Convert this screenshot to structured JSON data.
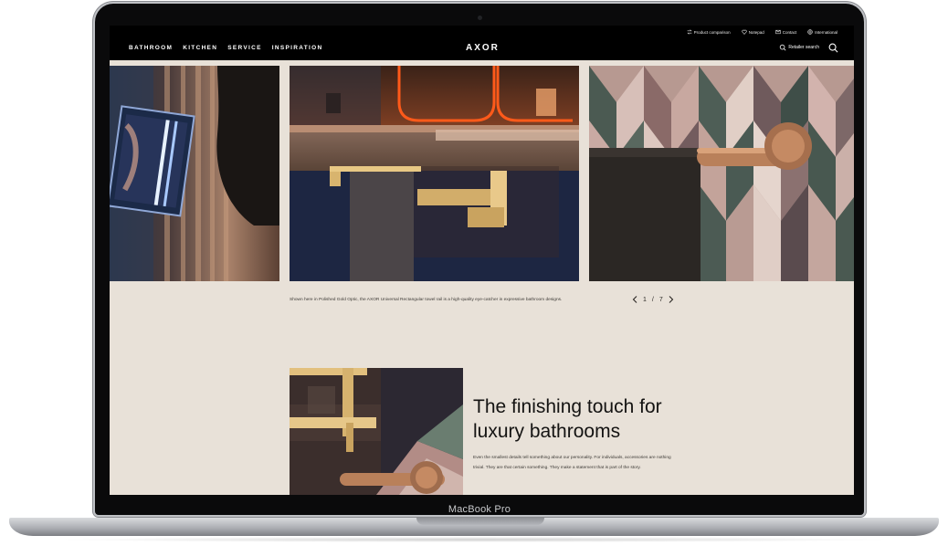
{
  "device": {
    "label": "MacBook Pro"
  },
  "header": {
    "utility_links": [
      {
        "label": "Product comparison",
        "icon": "compare-icon"
      },
      {
        "label": "Notepad",
        "icon": "heart-icon"
      },
      {
        "label": "Contact",
        "icon": "mail-icon"
      },
      {
        "label": "International",
        "icon": "globe-icon"
      }
    ],
    "nav": [
      {
        "label": "BATHROOM"
      },
      {
        "label": "KITCHEN"
      },
      {
        "label": "SERVICE"
      },
      {
        "label": "INSPIRATION"
      }
    ],
    "logo": "AXOR",
    "retailer_search": "Retailer search",
    "search_icon": "search-icon"
  },
  "gallery": {
    "caption": "Shown here in Polished Gold Optic, the AXOR Universal Rectangular towel rail is a high-quality eye-catcher in expressive bathroom designs.",
    "current": "1",
    "separator": "/",
    "total": "7"
  },
  "feature": {
    "title": "The finishing touch for luxury bathrooms",
    "body": "Even the smallest details tell something about our personality. For individuals, accessories are nothing trivial. They are that certain something. They make a statement that is part of the story."
  },
  "colors": {
    "page_bg": "#e8e1d8",
    "header_bg": "#000000",
    "gold": "#c9a35f",
    "copper": "#b9805a"
  }
}
